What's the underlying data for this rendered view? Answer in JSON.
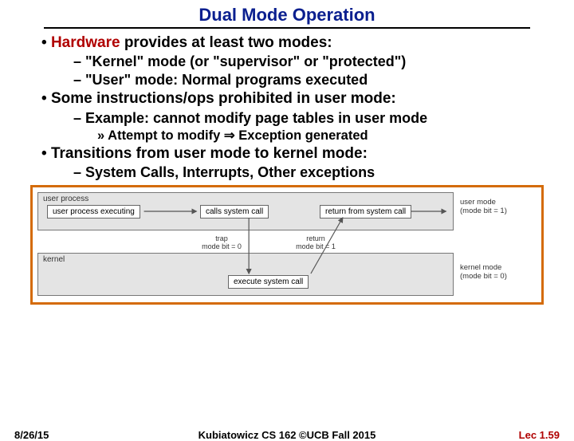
{
  "title": "Dual Mode Operation",
  "b1": {
    "hw": "Hardware",
    "rest": " provides at least two modes:"
  },
  "s1a": "\"Kernel\" mode (or \"supervisor\" or \"protected\")",
  "s1b": "\"User\" mode: Normal programs executed",
  "b2": "Some instructions/ops prohibited in user mode:",
  "s2a": "Example: cannot modify page tables in user mode",
  "s2a2": "Attempt to modify ⇒ Exception generated",
  "b3": "Transitions from user mode to kernel mode:",
  "s3a": "System Calls, Interrupts, Other exceptions",
  "diagram": {
    "user_panel": "user process",
    "kernel_panel": "kernel",
    "user_side": "user mode\n(mode bit = 1)",
    "kernel_side": "kernel mode\n(mode bit = 0)",
    "upe": "user process executing",
    "csc": "calls system call",
    "ret": "return from system call",
    "exe": "execute system call",
    "trap": "trap\nmode bit = 0",
    "retn": "return\nmode bit = 1"
  },
  "footer": {
    "date": "8/26/15",
    "mid": "Kubiatowicz CS 162 ©UCB Fall 2015",
    "lec": "Lec 1.59"
  }
}
